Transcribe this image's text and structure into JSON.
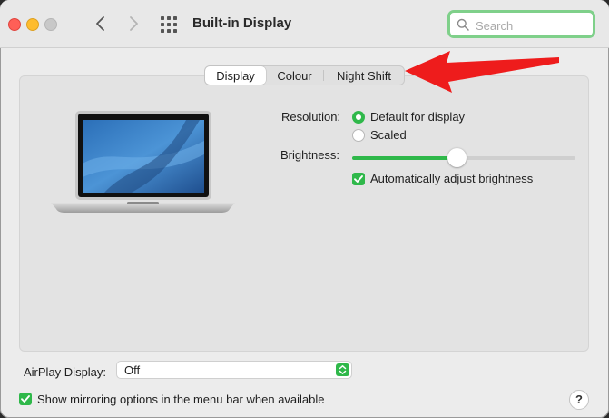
{
  "window": {
    "title": "Built-in Display"
  },
  "search": {
    "placeholder": "Search",
    "value": ""
  },
  "tabs": [
    {
      "label": "Display",
      "selected": true
    },
    {
      "label": "Colour",
      "selected": false
    },
    {
      "label": "Night Shift",
      "selected": false
    }
  ],
  "display": {
    "resolution_label": "Resolution:",
    "resolution_options": [
      {
        "label": "Default for display",
        "selected": true
      },
      {
        "label": "Scaled",
        "selected": false
      }
    ],
    "brightness_label": "Brightness:",
    "brightness_level": 0.47,
    "auto_brightness": {
      "label": "Automatically adjust brightness",
      "checked": true
    }
  },
  "airplay": {
    "label": "AirPlay Display:",
    "value": "Off"
  },
  "mirroring": {
    "label": "Show mirroring options in the menu bar when available",
    "checked": true
  },
  "help": {
    "label": "?"
  },
  "colors": {
    "accent": "#2fb84a",
    "arrow": "#ee1c1c",
    "search_highlight": "#7fd08a"
  },
  "icons": [
    "close-icon",
    "minimize-icon",
    "zoom-icon",
    "chevron-left-icon",
    "chevron-right-icon",
    "grid-icon",
    "search-icon",
    "laptop-image",
    "chevron-updown-icon",
    "checkmark-icon",
    "red-arrow-annotation"
  ]
}
